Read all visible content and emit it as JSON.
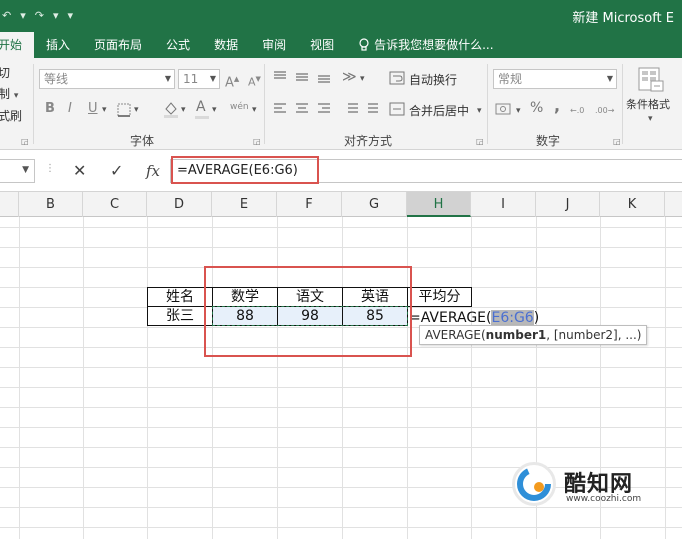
{
  "window": {
    "title": "新建 Microsoft E",
    "qat_undo": "↶",
    "qat_undo_menu": "▾",
    "qat_redo": "↷",
    "qat_redo_menu": "▾",
    "qat_customize": "▾"
  },
  "tabs": [
    {
      "label": "开始",
      "active": true
    },
    {
      "label": "插入"
    },
    {
      "label": "页面布局"
    },
    {
      "label": "公式"
    },
    {
      "label": "数据"
    },
    {
      "label": "审阅"
    },
    {
      "label": "视图"
    },
    {
      "label": "告诉我您想要做什么..."
    }
  ],
  "clipboard": {
    "cut": "剪切",
    "copy": "复制",
    "format_painter": "格式刷"
  },
  "font": {
    "font_name": "等线",
    "font_size": "11",
    "grow": "A",
    "shrink": "A",
    "bold": "B",
    "italic": "I",
    "underline": "U",
    "font_color_glyph": "A",
    "wen": "wén",
    "group_label": "字体"
  },
  "alignment": {
    "wrap_text": "自动换行",
    "merge_center": "合并后居中",
    "group_label": "对齐方式"
  },
  "number": {
    "format": "常规",
    "percent": "%",
    "comma": ",",
    "group_label": "数字"
  },
  "styles": {
    "conditional_format": "条件格式"
  },
  "formula_bar": {
    "cancel": "✕",
    "confirm": "✓",
    "fx": "fx",
    "value": "=AVERAGE(E6:G6)"
  },
  "columns": [
    {
      "label": "B"
    },
    {
      "label": "C"
    },
    {
      "label": "D"
    },
    {
      "label": "E"
    },
    {
      "label": "F"
    },
    {
      "label": "G"
    },
    {
      "label": "H"
    },
    {
      "label": "I"
    },
    {
      "label": "J"
    },
    {
      "label": "K"
    }
  ],
  "table": {
    "headers": [
      "姓名",
      "数学",
      "语文",
      "英语",
      "平均分"
    ],
    "row": {
      "name": "张三",
      "math": "88",
      "chinese": "98",
      "english": "85"
    }
  },
  "editing": {
    "prefix": "=AVERAGE(",
    "ref": "E6:G6",
    "suffix": ")"
  },
  "tooltip": {
    "func": "AVERAGE(",
    "arg1": "number1",
    "rest": ", [number2], ...)"
  },
  "watermark": {
    "name": "酷知网",
    "url": "www.coozhi.com"
  },
  "colors": {
    "excel_green": "#217346",
    "highlight_red": "#d9534f",
    "range_blue": "#4a6fd1"
  }
}
